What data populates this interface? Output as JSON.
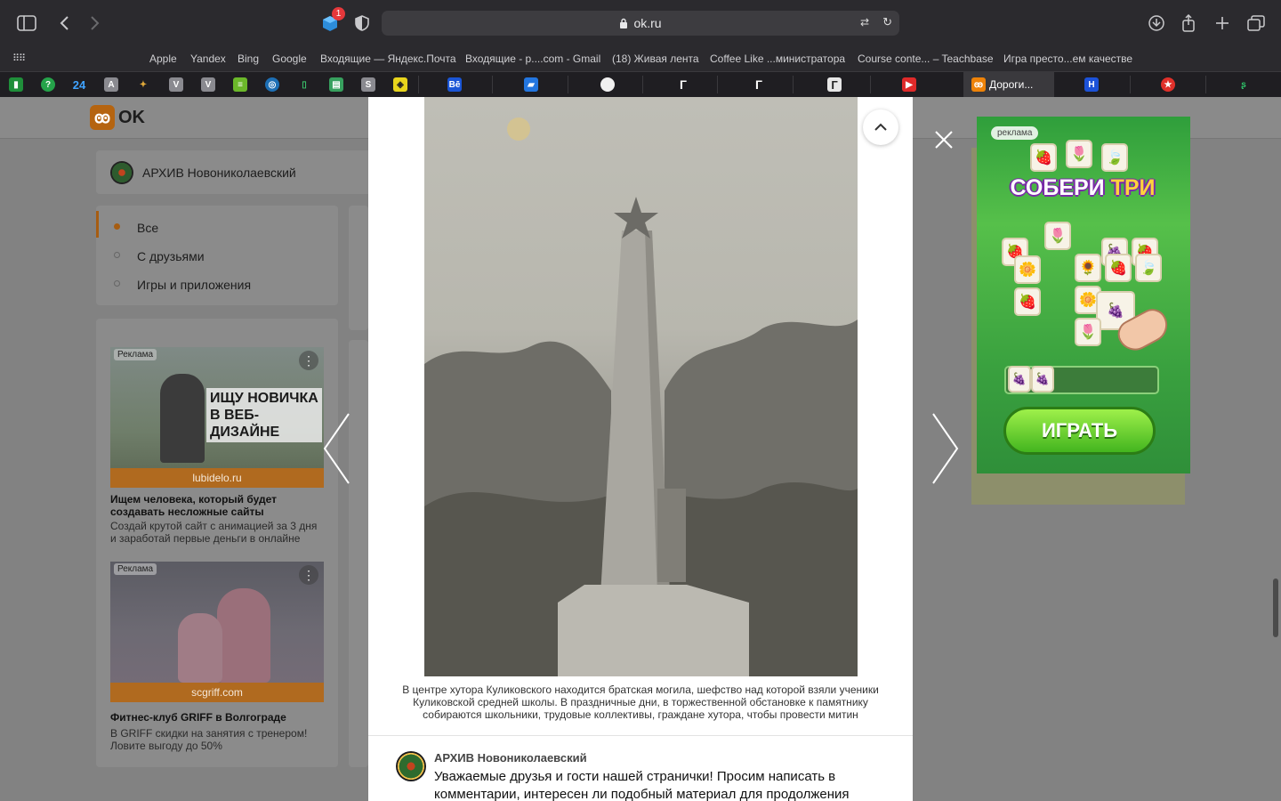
{
  "browser": {
    "url": "ok.ru",
    "extension_badge": "1",
    "favorites": [
      "Apple",
      "Yandex",
      "Bing",
      "Google",
      "Входящие — Яндекс.Почта",
      "Входящие - p....com - Gmail",
      "(18) Живая лента",
      "Coffee Like ...министратора",
      "Course conte... – Teachbase",
      "Игра престо...ем качестве"
    ],
    "pinned_tabs": [
      "24",
      "A",
      "V",
      "V",
      "S",
      "Bē",
      "Г",
      "Г",
      "Г"
    ],
    "active_tab_title": "Дороги..."
  },
  "ok": {
    "logo": "OK",
    "group_name": "АРХИВ Новониколаевский",
    "filters": [
      "Все",
      "С друзьями",
      "Игры и приложения"
    ],
    "ads": [
      {
        "tag": "Реклама",
        "banner_text": "ИЩУ НОВИЧКА В ВЕБ-ДИЗАЙНЕ",
        "domain": "lubidelo.ru",
        "title": "Ищем человека, который будет создавать несложные сайты",
        "text": "Создай крутой сайт с анимацией за 3 дня и заработай первые деньги в онлайне"
      },
      {
        "tag": "Реклама",
        "domain": "scgriff.com",
        "title": "Фитнес-клуб GRIFF в Волгограде",
        "text": "В GRIFF скидки на занятия с тренером! Ловите выгоду до 50%"
      }
    ]
  },
  "viewer": {
    "caption": "В центре хутора Куликовского находится братская могила, шефство над которой взяли ученики Куликовской средней школы. В праздничные дни, в торжественной обстановке к памятнику собираются школьники, трудовые коллективы, граждане хутора, чтобы провести митин",
    "comment_author": "АРХИВ Новониколаевский",
    "comment_text": "Уважаемые друзья и гости нашей странички! Просим написать в комментарии, интересен ли подобный материал для продолжения данной"
  },
  "game_ad": {
    "label": "реклама",
    "title_part1": "СОБЕРИ ",
    "title_part2": "ТРИ",
    "button": "ИГРАТЬ"
  }
}
